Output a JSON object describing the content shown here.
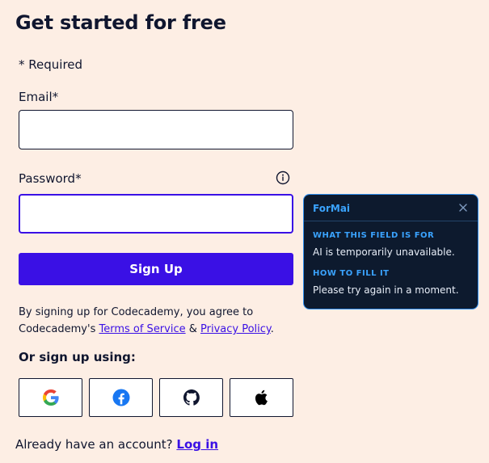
{
  "form": {
    "title": "Get started for free",
    "required_note": "* Required",
    "email_label": "Email*",
    "email_value": "",
    "password_label": "Password*",
    "password_value": "",
    "signup_label": "Sign Up",
    "agree_text": "By signing up for Codecademy, you agree to Codecademy's ",
    "terms_link": "Terms of Service",
    "agree_and": " & ",
    "privacy_link": "Privacy Policy",
    "agree_end": ".",
    "or_label": "Or sign up using:",
    "social_buttons": [
      {
        "name": "google",
        "icon": "google-icon"
      },
      {
        "name": "facebook",
        "icon": "facebook-icon"
      },
      {
        "name": "github",
        "icon": "github-icon"
      },
      {
        "name": "apple",
        "icon": "apple-icon"
      }
    ],
    "already_text": "Already have an account? ",
    "login_link": "Log in"
  },
  "tooltip": {
    "title": "ForMai",
    "section1_heading": "WHAT THIS FIELD IS FOR",
    "section1_text": "AI is temporarily unavailable.",
    "section2_heading": "HOW TO FILL IT",
    "section2_text": "Please try again in a moment."
  },
  "colors": {
    "background": "#fdeee4",
    "primary": "#3a10e5",
    "text": "#10162f",
    "tooltip_bg": "#0d1a2e",
    "tooltip_accent": "#3aa3ff"
  }
}
